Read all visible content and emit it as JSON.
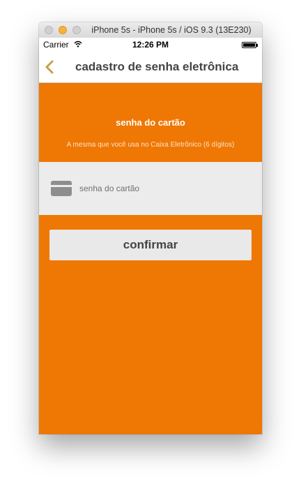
{
  "window": {
    "title": "iPhone 5s - iPhone 5s / iOS 9.3 (13E230)"
  },
  "status_bar": {
    "carrier": "Carrier",
    "time": "12:26 PM"
  },
  "nav": {
    "title": "cadastro de senha eletrônica",
    "back_icon": "chevron-left-icon",
    "accent_color": "#c9a04a"
  },
  "form": {
    "heading": "senha do cartão",
    "subheading": "A mesma que você usa no Caixa Eletrônico (6 dígitos)",
    "password_placeholder": "senha do cartão",
    "password_value": "",
    "card_icon": "credit-card-icon",
    "confirm_label": "confirmar"
  },
  "colors": {
    "background": "#ef7703",
    "field_background": "#ececec",
    "button_background": "#e9e9e9"
  }
}
